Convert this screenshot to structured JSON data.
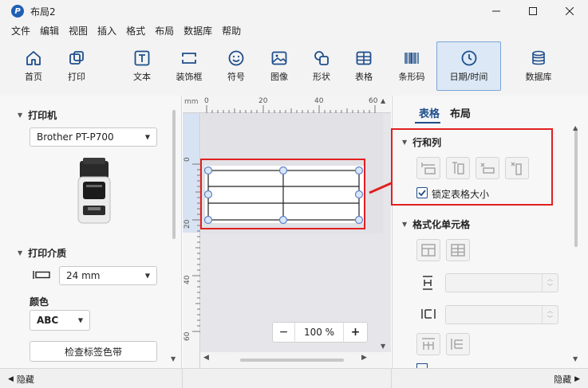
{
  "window": {
    "title": "布局2",
    "logo_letter": "P"
  },
  "menu": [
    "文件",
    "编辑",
    "视图",
    "插入",
    "格式",
    "布局",
    "数据库",
    "帮助"
  ],
  "toolbar": {
    "home": "首页",
    "print": "打印",
    "text": "文本",
    "frame": "装饰框",
    "symbol": "符号",
    "image": "图像",
    "shape": "形状",
    "table": "表格",
    "barcode": "条形码",
    "datetime": "日期/时间",
    "database": "数据库"
  },
  "left_panel": {
    "printer_heading": "打印机",
    "printer_value": "Brother PT-P700",
    "media_heading": "打印介质",
    "tape_width": "24 mm",
    "color_label": "颜色",
    "color_value": "ABC",
    "check_button": "检查标签色带"
  },
  "canvas": {
    "ruler_unit": "mm",
    "top_ticks": [
      "0",
      "20",
      "40",
      "60"
    ],
    "left_ticks": [
      "0",
      "20",
      "40",
      "60"
    ],
    "zoom_minus": "−",
    "zoom_value": "100 %",
    "zoom_plus": "+"
  },
  "right_panel": {
    "tab_table": "表格",
    "tab_layout": "布局",
    "rows_cols_heading": "行和列",
    "lock_size_label": "锁定表格大小",
    "lock_size_checked": true,
    "format_cells_heading": "格式化单元格"
  },
  "status": {
    "hide_left": "隐藏",
    "hide_right": "隐藏"
  },
  "colors": {
    "accent": "#1f5fb4",
    "highlight": "#e02020",
    "icon": "#1e4e8c"
  }
}
